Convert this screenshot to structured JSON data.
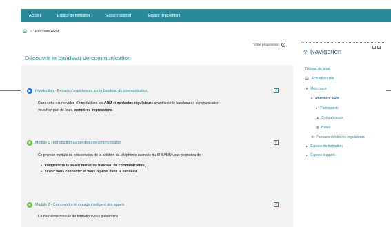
{
  "topnav": [
    "Accueil",
    "Espace de formation",
    "Espace support",
    "Espace déploiement"
  ],
  "breadcrumb": {
    "home_icon": "home-icon",
    "separator": ">",
    "current": "Parcours ARM"
  },
  "main": {
    "progress_label": "Votre progression",
    "section_title": "Découvrir le bandeau de communication"
  },
  "activities": {
    "intro": {
      "title": "Introduction - Retours d'expériences sur le bandeau de communication",
      "icon": "video-play-icon",
      "icon_color": "#1f6fd6",
      "desc_line1": "Dans cette courte vidéo d'introduction, les ARM et médecins régulateurs ayant testé le bandeau de communication",
      "desc_line2": "vous font part de leurs premières impressions."
    },
    "module1": {
      "title": "Module 1 - Introduction au bandeau de communication",
      "icon": "scorm-package-icon",
      "icon_color": "#6cc24a",
      "desc": "Ce premier module de présentation de la solution de téléphonie avancée du SI-SAMU vous permettra de :",
      "bullet1": "comprendre la valeur métier du bandeau de communication,",
      "bullet2": "savoir vous connecter et vous repérer dans le bandeau."
    },
    "module2": {
      "title": "Module 2 - Comprendre le routage intelligent des appels",
      "icon": "scorm-package-icon",
      "icon_color": "#6cc24a",
      "desc": "Ce deuxième module de formation vous présentera :"
    }
  },
  "sidebar": {
    "title": "Navigation",
    "items": [
      "Tableau de bord",
      "Accueil du site",
      "Mes cours",
      "Parcours ARM",
      "Participants",
      "Compétences",
      "Notes",
      "Parcours médecins régulateurs",
      "Espace de formation",
      "Espace support"
    ]
  },
  "colors": {
    "accent": "#2b8a99",
    "nav_title": "#2b5f8a",
    "section_bg": "#f2f2f2"
  }
}
